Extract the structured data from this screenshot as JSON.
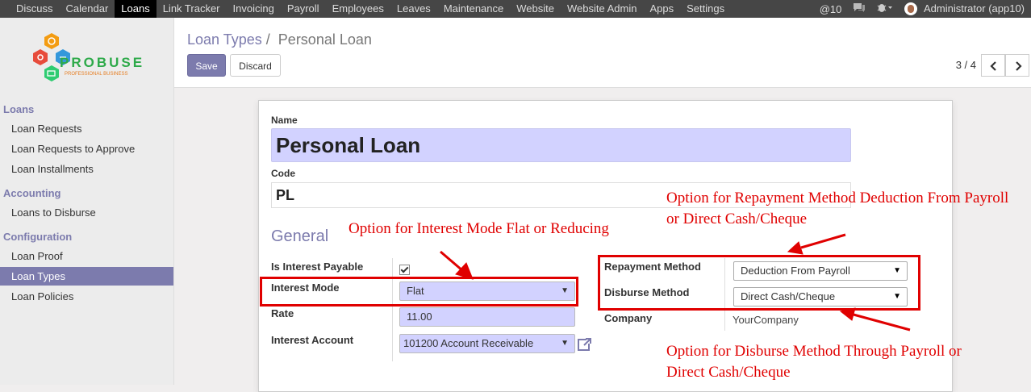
{
  "top_menu": {
    "items": [
      "Discuss",
      "Calendar",
      "Loans",
      "Link Tracker",
      "Invoicing",
      "Payroll",
      "Employees",
      "Leaves",
      "Maintenance",
      "Website",
      "Website Admin",
      "Apps",
      "Settings"
    ],
    "active": "Loans",
    "notifications": "@10",
    "user": "Administrator (app10)"
  },
  "logo": {
    "brand": "PROBUSE",
    "tagline": "PROFESSIONAL BUSINESS"
  },
  "sidebar": {
    "sections": [
      {
        "title": "Loans",
        "items": [
          "Loan Requests",
          "Loan Requests to Approve",
          "Loan Installments"
        ]
      },
      {
        "title": "Accounting",
        "items": [
          "Loans to Disburse"
        ]
      },
      {
        "title": "Configuration",
        "items": [
          "Loan Proof",
          "Loan Types",
          "Loan Policies"
        ]
      }
    ],
    "active": "Loan Types"
  },
  "control_panel": {
    "breadcrumb_parent": "Loan Types",
    "breadcrumb_sep": "/",
    "breadcrumb_current": "Personal Loan",
    "save_label": "Save",
    "discard_label": "Discard",
    "pager": "3 / 4"
  },
  "form": {
    "name_label": "Name",
    "name_value": "Personal Loan",
    "code_label": "Code",
    "code_value": "PL",
    "general_title": "General",
    "is_interest_payable_label": "Is Interest Payable",
    "is_interest_payable": true,
    "interest_mode_label": "Interest Mode",
    "interest_mode_value": "Flat",
    "rate_label": "Rate",
    "rate_value": "11.00",
    "interest_account_label": "Interest Account",
    "interest_account_value": "101200 Account Receivable",
    "repayment_method_label": "Repayment Method",
    "repayment_method_value": "Deduction From Payroll",
    "disburse_method_label": "Disburse Method",
    "disburse_method_value": "Direct Cash/Cheque",
    "company_label": "Company",
    "company_value": "YourCompany"
  },
  "annotations": {
    "repayment_note_line1": "Option for Repayment Method Deduction From Payroll",
    "repayment_note_line2": "or Direct Cash/Cheque",
    "interest_note": "Option for Interest Mode Flat or Reducing",
    "disburse_note_line1": "Option for Disburse Method Through Payroll or",
    "disburse_note_line2": "Direct Cash/Cheque",
    "color": "#e00000"
  },
  "colors": {
    "accent": "#7c7bad",
    "topbar": "#464646",
    "required_field": "#d2d2ff"
  }
}
